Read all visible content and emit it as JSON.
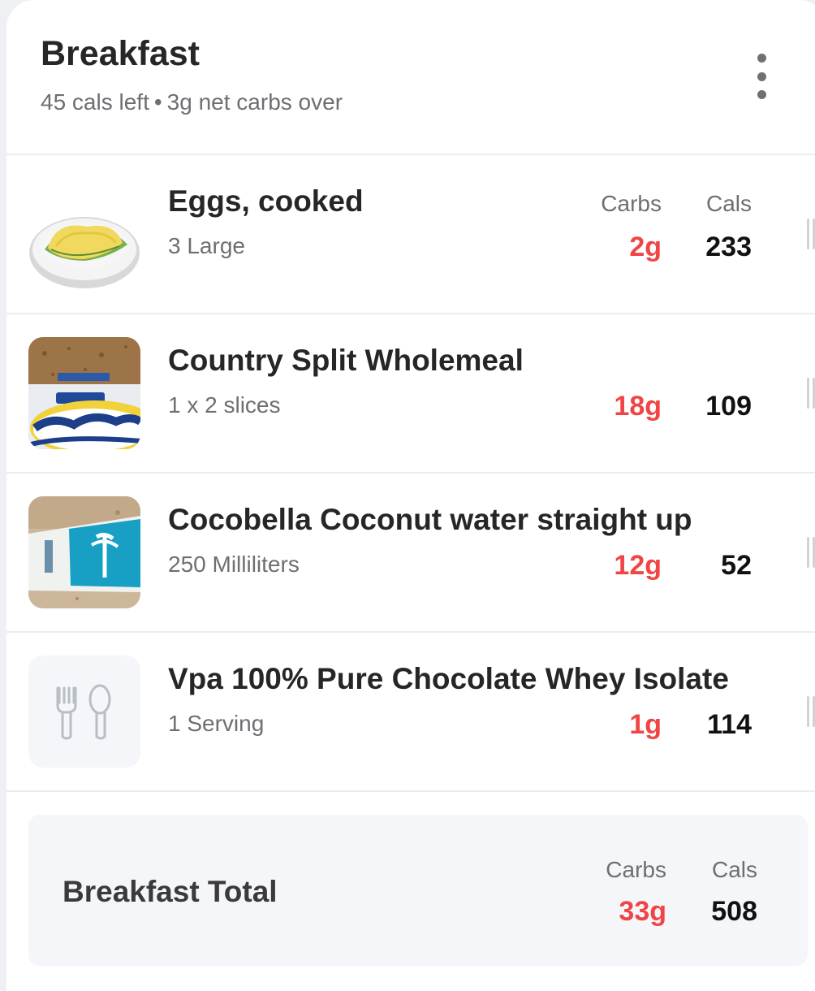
{
  "meal": {
    "title": "Breakfast",
    "cals_left": "45 cals left",
    "separator": "•",
    "carbs_status": "3g net carbs over"
  },
  "columns": {
    "carbs": "Carbs",
    "cals": "Cals"
  },
  "items": [
    {
      "name": "Eggs, cooked",
      "serving": "3 Large",
      "carbs": "2g",
      "cals": "233",
      "show_headers": true,
      "thumb": "eggs-photo"
    },
    {
      "name": "Country Split Wholemeal",
      "serving": "1 x 2 slices",
      "carbs": "18g",
      "cals": "109",
      "show_headers": false,
      "thumb": "bread-photo"
    },
    {
      "name": "Cocobella Coconut water straight up",
      "serving": "250 Milliliters",
      "carbs": "12g",
      "cals": "52",
      "show_headers": false,
      "thumb": "coconut-water-photo"
    },
    {
      "name": "Vpa 100% Pure Chocolate Whey Isolate",
      "serving": "1 Serving",
      "carbs": "1g",
      "cals": "114",
      "show_headers": false,
      "thumb": "fork-spoon-icon"
    }
  ],
  "total": {
    "label": "Breakfast Total",
    "carbs": "33g",
    "cals": "508"
  },
  "colors": {
    "carbs_red": "#f04545",
    "text_dark": "#262626",
    "text_muted": "#6e6e73",
    "total_bg": "#f4f6f9"
  }
}
